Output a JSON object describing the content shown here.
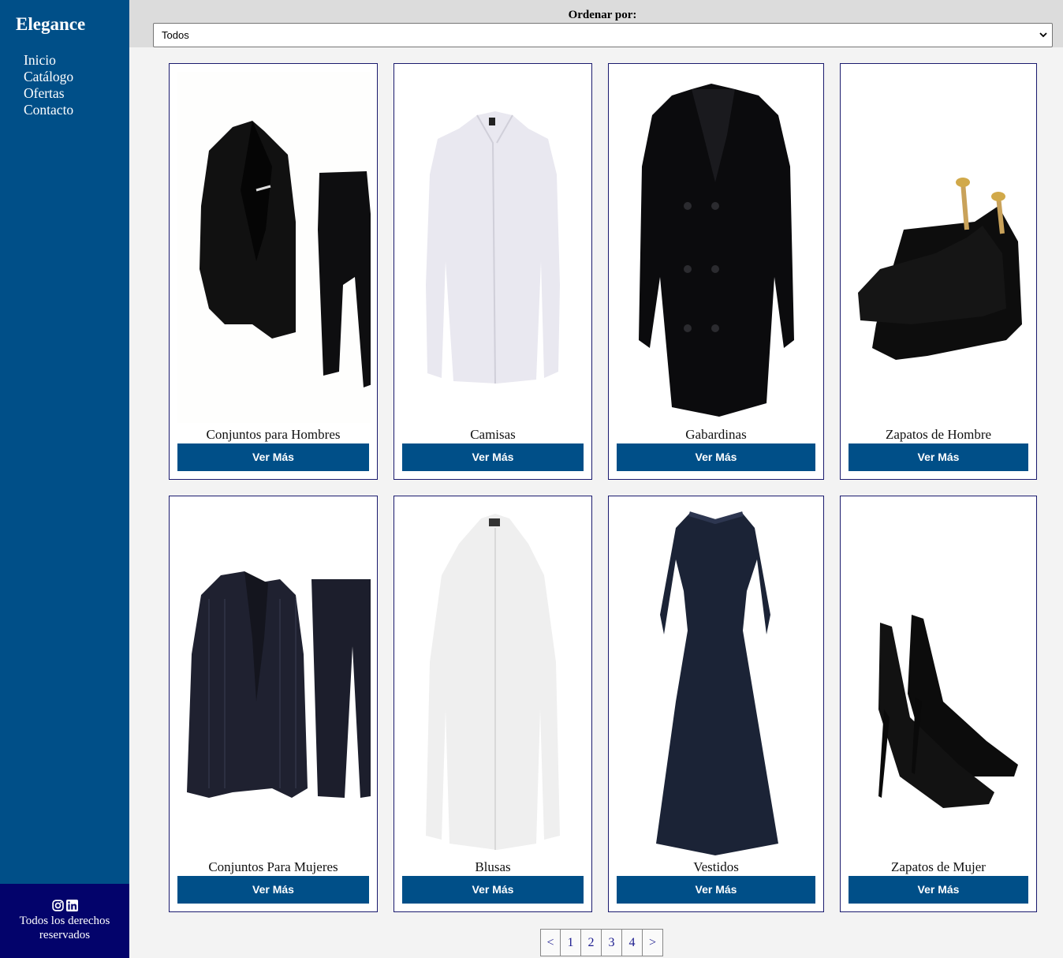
{
  "brand": "Elegance",
  "nav": [
    "Inicio",
    "Catálogo",
    "Ofertas",
    "Contacto"
  ],
  "footer": {
    "rights": "Todos los derechos reservados",
    "social_icons": [
      "instagram-icon",
      "linkedin-icon"
    ]
  },
  "sort": {
    "label": "Ordenar por:",
    "selected": "Todos"
  },
  "products": [
    {
      "title": "Conjuntos para Hombres",
      "button": "Ver Más",
      "image": "men-suit"
    },
    {
      "title": "Camisas",
      "button": "Ver Más",
      "image": "white-shirt"
    },
    {
      "title": "Gabardinas",
      "button": "Ver Más",
      "image": "black-coat"
    },
    {
      "title": "Zapatos de Hombre",
      "button": "Ver Más",
      "image": "men-shoes"
    },
    {
      "title": "Conjuntos Para Mujeres",
      "button": "Ver Más",
      "image": "women-suit"
    },
    {
      "title": "Blusas",
      "button": "Ver Más",
      "image": "white-blouse"
    },
    {
      "title": "Vestidos",
      "button": "Ver Más",
      "image": "lace-dress"
    },
    {
      "title": "Zapatos de Mujer",
      "button": "Ver Más",
      "image": "heels"
    }
  ],
  "pagination": [
    "<",
    "1",
    "2",
    "3",
    "4",
    ">"
  ],
  "colors": {
    "sidebar": "#004f88",
    "footer": "#03036b",
    "button": "#004f88"
  }
}
